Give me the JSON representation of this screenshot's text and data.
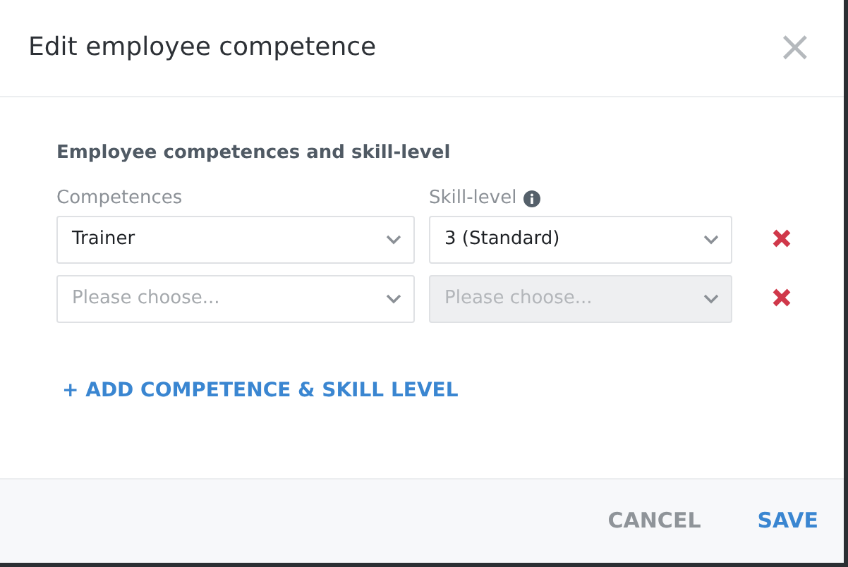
{
  "dialog": {
    "title": "Edit employee competence",
    "close_label": "×"
  },
  "section_title": "Employee competences and skill-level",
  "columns": [
    {
      "label": "Competences",
      "info": false
    },
    {
      "label": "Skill-level",
      "info": true
    }
  ],
  "rows": [
    {
      "competence": {
        "value": "Trainer",
        "disabled": false
      },
      "skill": {
        "value": "3 (Standard)",
        "disabled": false
      }
    },
    {
      "competence": {
        "placeholder": "Please choose...",
        "disabled": false
      },
      "skill": {
        "placeholder": "Please choose...",
        "disabled": true
      }
    }
  ],
  "add_link": "+ ADD COMPETENCE & SKILL LEVEL",
  "buttons": [
    {
      "label": "CANCEL",
      "kind": "secondary"
    },
    {
      "label": "SAVE",
      "kind": "primary"
    }
  ]
}
